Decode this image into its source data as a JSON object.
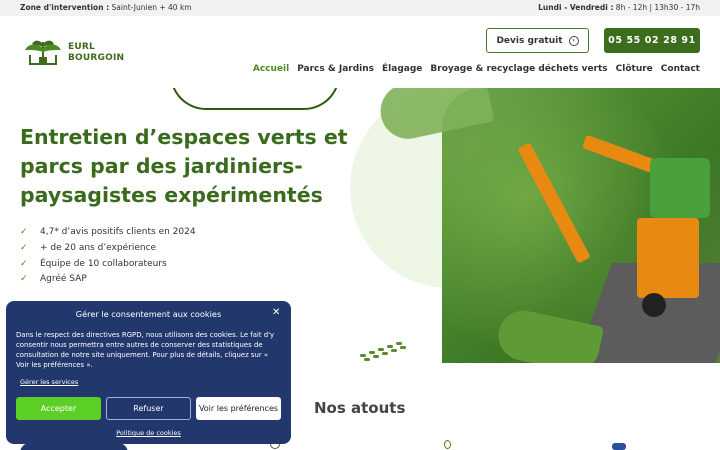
{
  "topbar": {
    "zone_label": "Zone d'intervention :",
    "zone_value": "Saint-Junien + 40 km",
    "hours_label": "Lundi - Vendredi :",
    "hours_value": "8h - 12h | 13h30 - 17h"
  },
  "header": {
    "logo_line1": "EURL",
    "logo_line2": "BOURGOIN",
    "devis_label": "Devis gratuit",
    "phone": "05 55 02 28 91",
    "nav": [
      "Accueil",
      "Parcs & Jardins",
      "Élagage",
      "Broyage & recyclage déchets verts",
      "Clôture",
      "Contact"
    ]
  },
  "hero": {
    "title": "Entretien d’espaces verts et parcs par des jardiniers-paysagistes expérimentés",
    "checks": [
      "4,7* d’avis positifs clients en 2024",
      "+ de 20 ans d’expérience",
      "Équipe de 10 collaborateurs",
      "Agréé SAP"
    ]
  },
  "section": {
    "atouts_title": "Nos atouts"
  },
  "cookie": {
    "title": "Gérer le consentement aux cookies",
    "body": "Dans le respect des directives RGPD, nous utilisons des cookies. Le fait d'y consentir nous permettra entre autres de conserver des statistiques de consultation de notre site uniquement. Pour plus de détails, cliquez sur « Voir les préférences ».",
    "services_link": "Gérer les services",
    "accept": "Accepter",
    "refuse": "Refuser",
    "prefs": "Voir les préférences",
    "policy": "Politique de cookies"
  },
  "colors": {
    "brand_green": "#3c6d1c",
    "accent_green": "#4e8a24",
    "modal_bg": "#22386d",
    "accept_bg": "#5ccf27"
  }
}
